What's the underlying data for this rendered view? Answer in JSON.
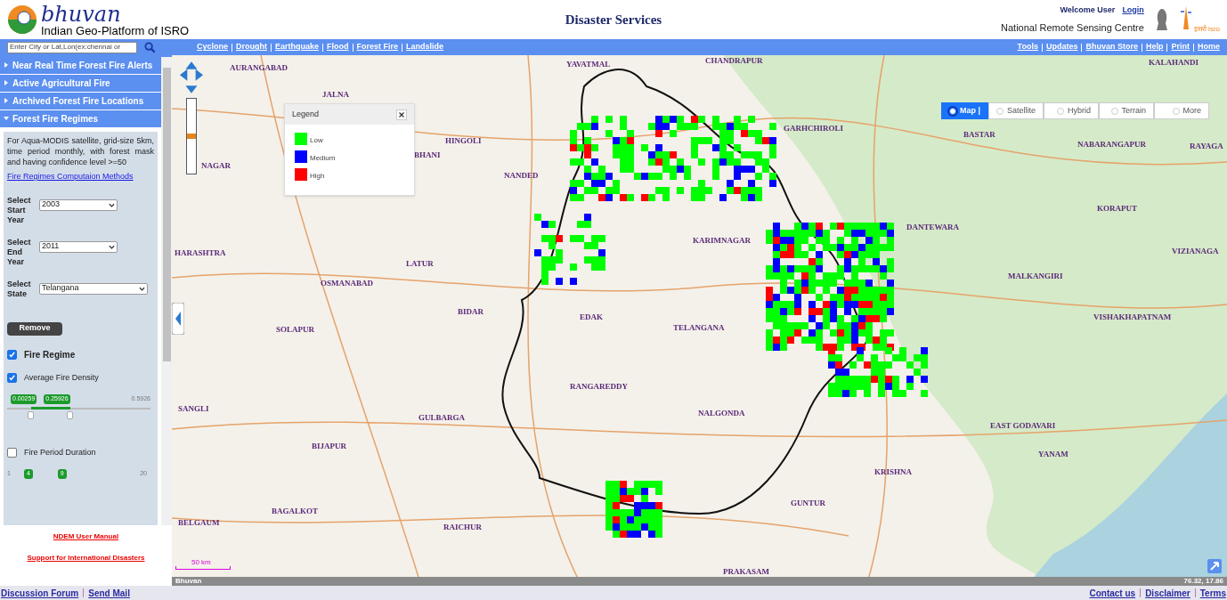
{
  "header": {
    "brand": "bhuvan",
    "subtitle": "Indian Geo-Platform of ISRO",
    "title": "Disaster Services",
    "welcome": "Welcome User",
    "login": "Login",
    "org": "National Remote Sensing Centre",
    "isro_text": "इसरो isro"
  },
  "search": {
    "placeholder": "Enter City or Lat,Lon(ex:chennai or"
  },
  "nav_links": [
    "Cyclone",
    "Drought",
    "Earthquake",
    "Flood",
    "Forest Fire",
    "Landslide"
  ],
  "top_links": [
    "Tools",
    "Updates",
    "Bhuvan Store",
    "Help",
    "Print",
    "Home"
  ],
  "sidebar": {
    "sections": [
      {
        "label": "Near Real Time Forest Fire Alerts",
        "expanded": false
      },
      {
        "label": "Active Agricultural Fire",
        "expanded": false
      },
      {
        "label": "Archived Forest Fire Locations",
        "expanded": false
      },
      {
        "label": "Forest Fire Regimes",
        "expanded": true
      }
    ],
    "description": "For Aqua-MODIS satellite, grid-size 5km, time period monthly, with forest mask and having confidence level >=50",
    "method_link": "Fire Regimes Computaion Methods",
    "selects": [
      {
        "label": "Select Start Year",
        "value": "2003"
      },
      {
        "label": "Select End Year",
        "value": "2011"
      },
      {
        "label": "Select State",
        "value": "Telangana"
      }
    ],
    "remove_button": "Remove",
    "fire_regime": {
      "label": "Fire Regime",
      "checked": true
    },
    "density": {
      "label": "Average Fire Density",
      "checked": true,
      "min": "0.00259",
      "max_sel": "0.25926",
      "max": "0.5926",
      "thumbs": [
        {
          "level": 0.17
        },
        {
          "level": 0.44
        }
      ]
    },
    "duration": {
      "label": "Fire Period Duration",
      "checked": false,
      "min": "1",
      "low": "4",
      "high": "9",
      "max": "20"
    },
    "links": [
      "NDEM User Manual",
      "Support for International Disasters"
    ]
  },
  "map": {
    "legend": {
      "title": "Legend",
      "items": [
        {
          "label": "Low",
          "color": "#00ff00"
        },
        {
          "label": "Medium",
          "color": "#0000ff"
        },
        {
          "label": "High",
          "color": "#ff0000"
        }
      ]
    },
    "map_types": [
      {
        "label": "Map |",
        "selected": true
      },
      {
        "label": "Satellite",
        "selected": false
      },
      {
        "label": "Hybrid",
        "selected": false
      },
      {
        "label": "Terrain",
        "selected": false
      },
      {
        "label": "More",
        "selected": false
      }
    ],
    "zoom": {
      "level": 0.5
    },
    "places": [
      "AURANGABAD",
      "JALNA",
      "HINGOLI",
      "YAVATMAL",
      "CHANDRAPUR",
      "GARHCHIROLI",
      "KALAHANDI",
      "BASTAR",
      "NABARANGAPUR",
      "RAYAGA",
      "NAGAR",
      "HARASHTRA",
      "LATUR",
      "OSMANABAD",
      "BIDAR",
      "SOLAPUR",
      "TELANGANA",
      "RANGAREDDY",
      "NALGONDA",
      "GULBARGA",
      "SANGLI",
      "BIJAPUR",
      "BELGAUM",
      "BAGALKOT",
      "RAICHUR",
      "GUNTUR",
      "KRISHNA",
      "EAST GODAVARI",
      "YANAM",
      "PRAKASAM",
      "DANTEWARA",
      "KORAPUT",
      "MALKANGIRI",
      "VIZIANAGA",
      "VISHAKHAPATNAM",
      "KARIMNAGAR",
      "NANDED",
      "BHANI",
      "EDAK"
    ],
    "scale": "50 km",
    "source": "Bhuvan",
    "coords": "76.32, 17.86"
  },
  "footer": {
    "left": [
      "Discussion Forum",
      "Send Mail"
    ],
    "right": [
      "Contact us",
      "Disclaimer",
      "Terms"
    ]
  }
}
